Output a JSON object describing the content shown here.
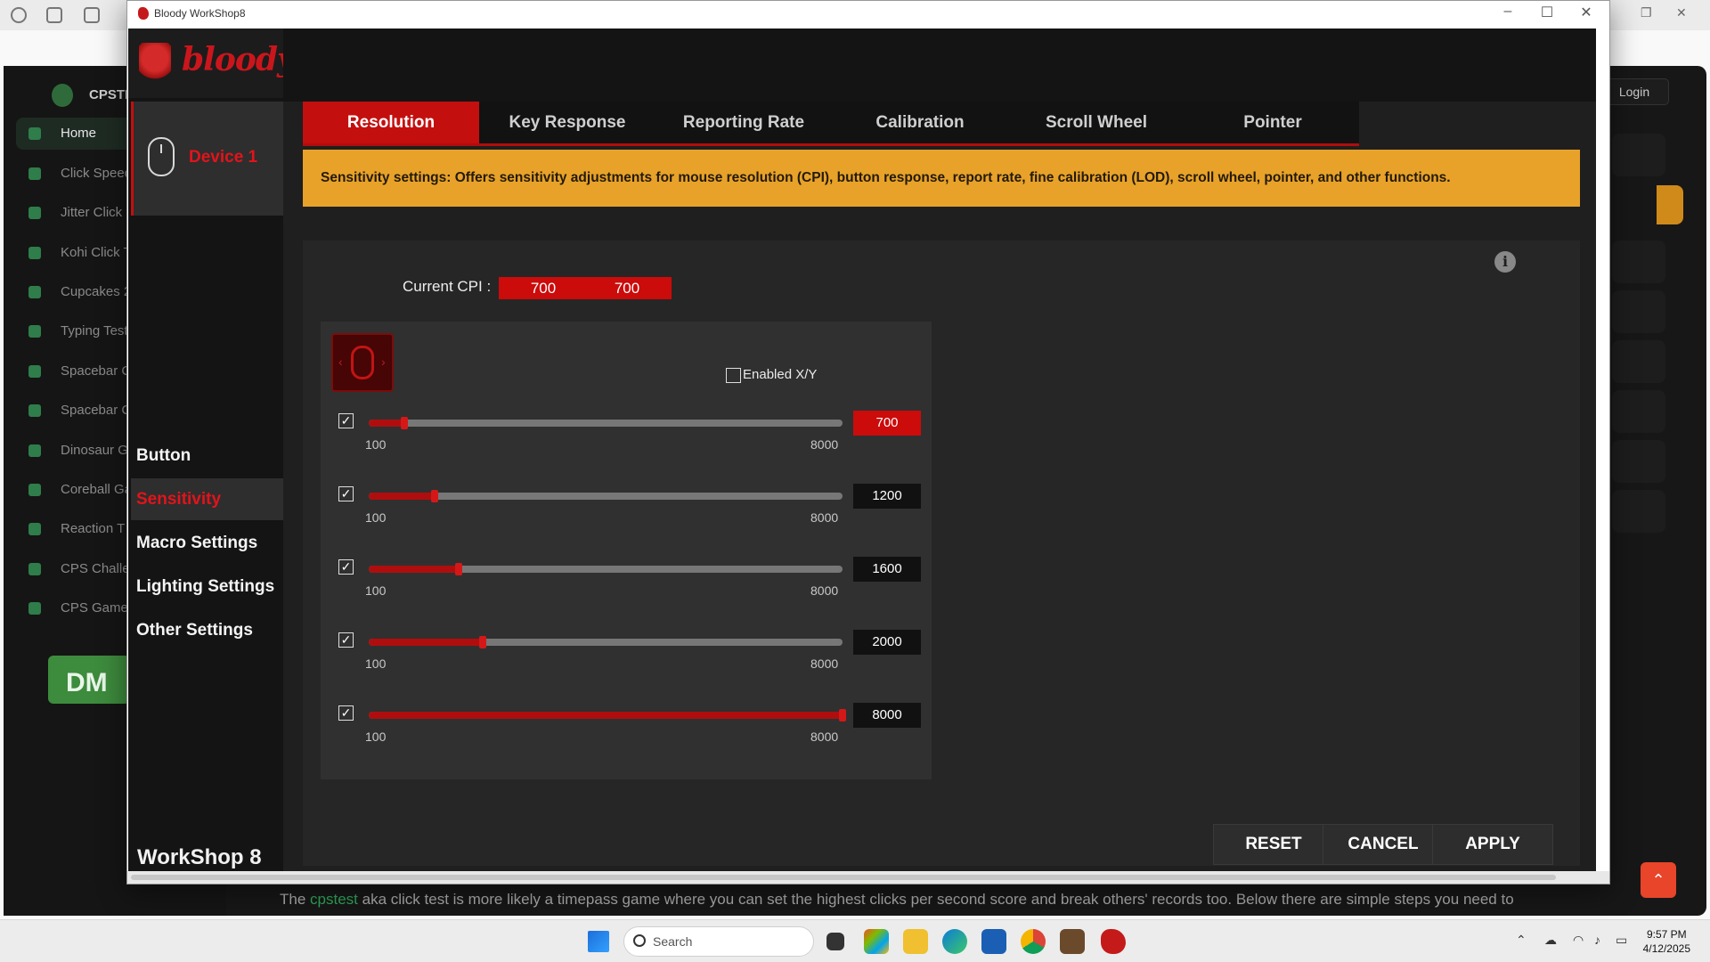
{
  "app": {
    "window_title": "Bloody WorkShop8",
    "brand_word": "bloody",
    "device": "Device 1",
    "footer": "WorkShop 8",
    "nav": [
      {
        "label": "Button",
        "active": false
      },
      {
        "label": "Sensitivity",
        "active": true
      },
      {
        "label": "Macro Settings",
        "active": false
      },
      {
        "label": "Lighting Settings",
        "active": false
      },
      {
        "label": "Other Settings",
        "active": false
      }
    ],
    "tabs": [
      {
        "label": "Resolution",
        "active": true
      },
      {
        "label": "Key Response",
        "active": false
      },
      {
        "label": "Reporting Rate",
        "active": false
      },
      {
        "label": "Calibration",
        "active": false
      },
      {
        "label": "Scroll Wheel",
        "active": false
      },
      {
        "label": "Pointer",
        "active": false
      }
    ],
    "banner": "Sensitivity settings: Offers sensitivity adjustments for mouse resolution (CPI), button response, report rate, fine calibration (LOD), scroll wheel, pointer, and other functions.",
    "current_cpi_label": "Current CPI :",
    "current_cpi_x": "700",
    "current_cpi_y": "700",
    "enabled_xy_label": "Enabled X/Y",
    "enabled_xy_checked": false,
    "slider_min_label": "100",
    "slider_max_label": "8000",
    "cpi_levels": [
      {
        "value": "700",
        "checked": true,
        "active": true
      },
      {
        "value": "1200",
        "checked": true,
        "active": false
      },
      {
        "value": "1600",
        "checked": true,
        "active": false
      },
      {
        "value": "2000",
        "checked": true,
        "active": false
      },
      {
        "value": "8000",
        "checked": true,
        "active": false
      }
    ],
    "buttons": {
      "reset": "RESET",
      "cancel": "CANCEL",
      "apply": "APPLY"
    },
    "colors": {
      "accent": "#c40f0f",
      "banner": "#e8a22a",
      "panel": "#262626"
    }
  },
  "site": {
    "logo_text": "CPSTI",
    "login": "Login",
    "sidebar": [
      "Home",
      "Click Speed",
      "Jitter Click",
      "Kohi Click T",
      "Cupcakes 2",
      "Typing Test",
      "Spacebar C",
      "Spacebar Cl",
      "Dinosaur Ga",
      "Coreball Ga",
      "Reaction T",
      "CPS Challe",
      "CPS Games"
    ],
    "dmca": "DM",
    "footer_before": "The ",
    "footer_link": "cpstest",
    "footer_after": " aka click test is more likely a timepass game where you can set the highest clicks per second score and break others' records too. Below there are simple steps you need to"
  },
  "taskbar": {
    "search_placeholder": "Search",
    "time": "9:57 PM",
    "date": "4/12/2025"
  }
}
